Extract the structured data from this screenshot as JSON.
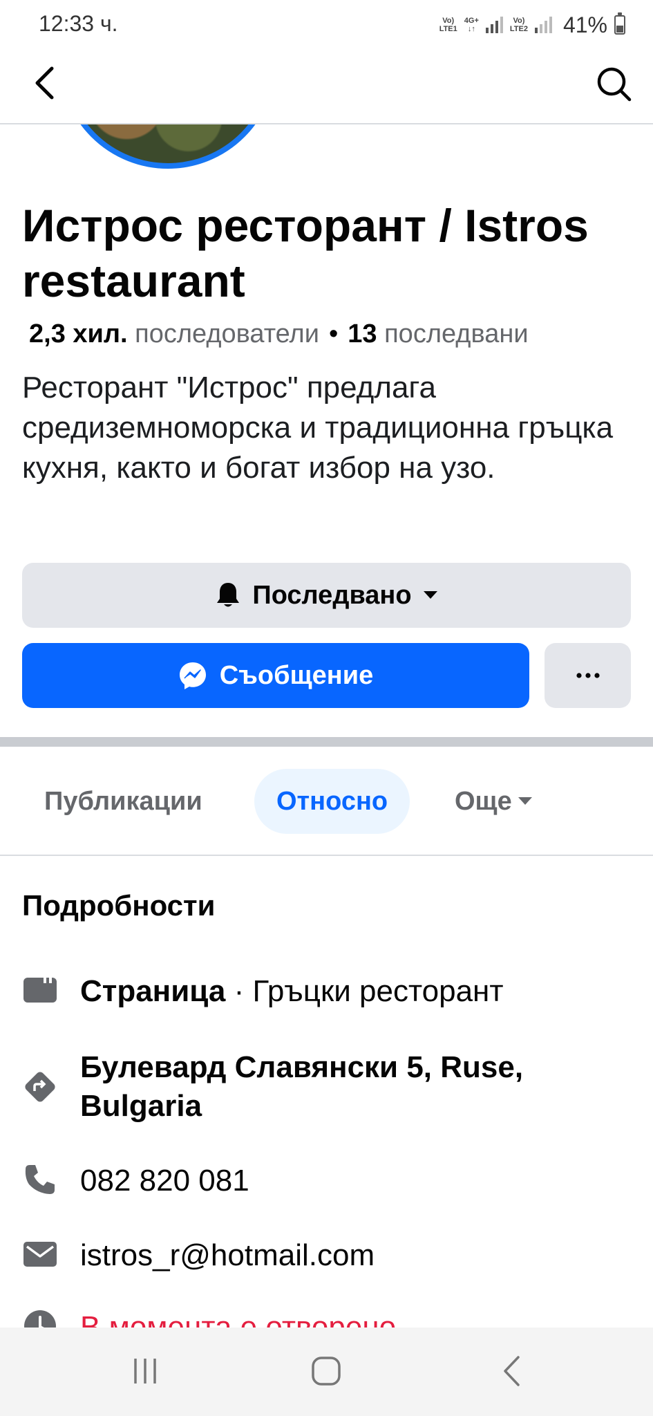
{
  "status_bar": {
    "time": "12:33 ч.",
    "sim1": "Vo) LTE1",
    "network": "4G+",
    "sim2": "Vo) LTE2",
    "battery": "41%"
  },
  "topbar": {
    "back_icon": "chevron-left-icon",
    "search_icon": "search-icon"
  },
  "page": {
    "title": "Истрос ресторант / Istros restaurant",
    "followers_count": "2,3 хил.",
    "followers_label": "последователи",
    "separator": "•",
    "following_count": "13",
    "following_label": "последвани",
    "description": "Ресторант \"Истрос\" предлага средиземноморска и традиционна гръцка кухня, както и богат избор на узо."
  },
  "actions": {
    "follow_label": "Последвано",
    "message_label": "Съобщение",
    "more_label": "···"
  },
  "tabs": [
    {
      "label": "Публикации",
      "active": false
    },
    {
      "label": "Относно",
      "active": true
    },
    {
      "label": "Още",
      "active": false
    }
  ],
  "details": {
    "heading": "Подробности",
    "page_type_bold": "Страница",
    "page_type_rest": " · Гръцки ресторант",
    "address": "Булевард Славянски 5, Ruse, Bulgaria",
    "phone": "082 820 081",
    "email": "istros_r@hotmail.com",
    "open_status": "В момента е отворено"
  },
  "colors": {
    "accent": "#0866ff",
    "tab_active_bg": "#ebf5ff",
    "button_gray": "#e4e6eb",
    "status_red": "#e41e3f"
  }
}
